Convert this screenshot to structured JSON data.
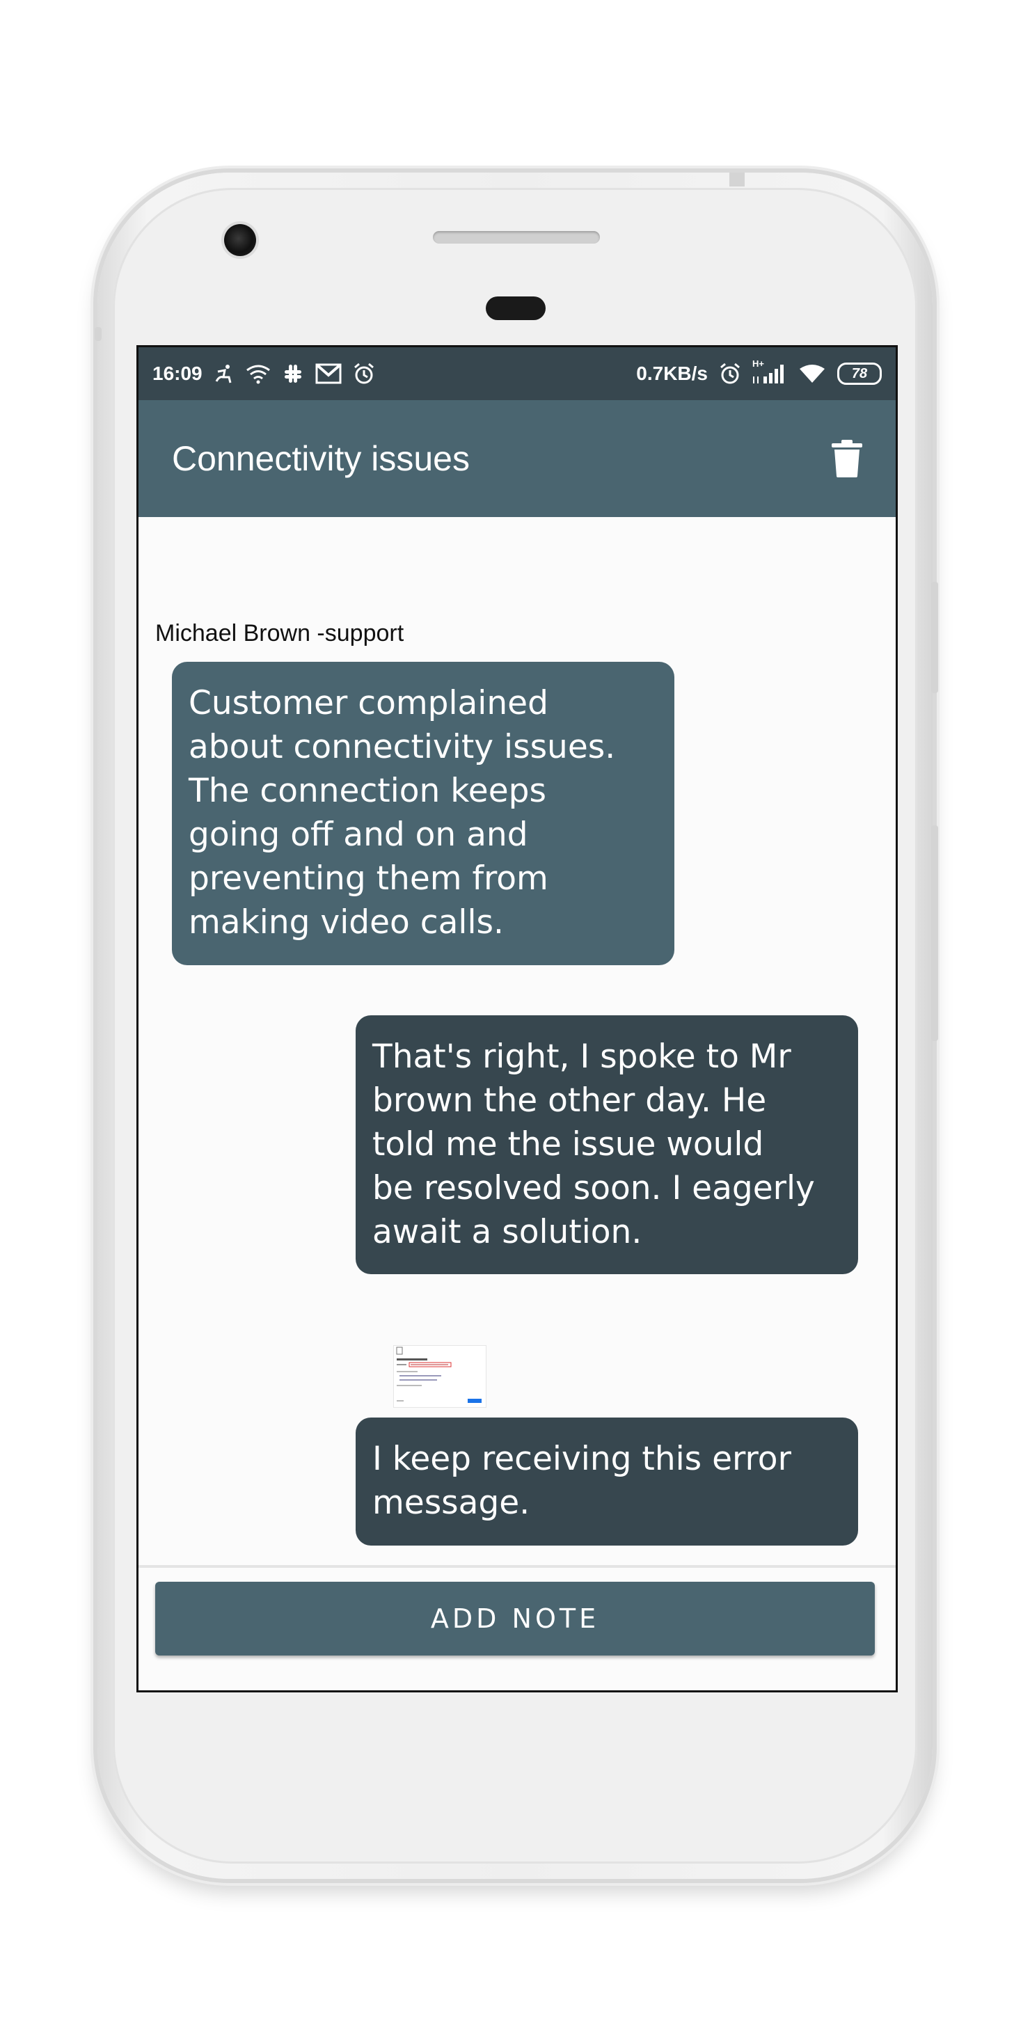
{
  "status_bar": {
    "time": "16:09",
    "network_speed": "0.7KB/s",
    "network_type": "H+",
    "battery": "78",
    "icons_left": [
      "accessibility-icon",
      "wifi-icon",
      "slack-icon",
      "gmail-icon",
      "alarm-icon"
    ],
    "icons_right": [
      "alarm-icon",
      "signal-icon",
      "wifi-icon",
      "battery-icon"
    ]
  },
  "app_bar": {
    "title": "Connectivity issues",
    "delete_icon": "trash-icon"
  },
  "messages": [
    {
      "sender": "Michael Brown -support",
      "text": "Customer complained\nabout connectivity issues.\nThe connection keeps\ngoing off and on and\npreventing them from\nmaking video calls.",
      "side": "left"
    },
    {
      "text": "That's right, I spoke to Mr\nbrown the other day. He\ntold me the issue would\nbe resolved soon. I eagerly\nawait a solution.",
      "side": "right"
    },
    {
      "attachment": "error-screenshot-thumbnail",
      "text": "I keep receiving this error\nmessage.",
      "side": "right"
    }
  ],
  "footer": {
    "add_note_label": "ADD NOTE"
  },
  "colors": {
    "status_bar": "#37474f",
    "app_bar": "#4a6570",
    "bubble_left": "#4a6570",
    "bubble_right": "#37474f",
    "background": "#fbfbfb"
  }
}
